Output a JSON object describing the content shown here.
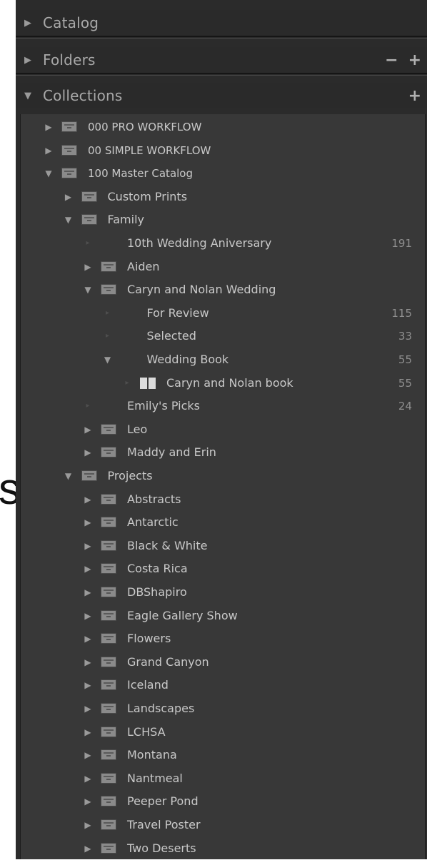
{
  "background_text": "s",
  "panel": {
    "catalog": {
      "label": "Catalog"
    },
    "folders": {
      "label": "Folders",
      "minus": "−",
      "plus": "+"
    },
    "collections": {
      "label": "Collections",
      "plus": "+"
    }
  },
  "collections_tree": [
    {
      "name": "000 PRO WORKFLOW",
      "type": "set",
      "state": "collapsed",
      "depth": 0,
      "count": ""
    },
    {
      "name": "00 SIMPLE WORKFLOW",
      "type": "set",
      "state": "collapsed",
      "depth": 0,
      "count": ""
    },
    {
      "name": "100 Master Catalog",
      "type": "set",
      "state": "expanded",
      "depth": 0,
      "count": ""
    },
    {
      "name": "Custom Prints",
      "type": "set",
      "state": "collapsed",
      "depth": 1,
      "count": ""
    },
    {
      "name": "Family",
      "type": "set",
      "state": "expanded",
      "depth": 1,
      "count": ""
    },
    {
      "name": "10th Wedding Aniversary",
      "type": "collection",
      "state": "leaf",
      "depth": 2,
      "count": "191"
    },
    {
      "name": "Aiden",
      "type": "set",
      "state": "collapsed",
      "depth": 2,
      "count": ""
    },
    {
      "name": "Caryn and Nolan Wedding",
      "type": "set",
      "state": "expanded",
      "depth": 2,
      "count": ""
    },
    {
      "name": "For Review",
      "type": "collection",
      "state": "leaf",
      "depth": 3,
      "count": "115"
    },
    {
      "name": "Selected",
      "type": "collection",
      "state": "leaf",
      "depth": 3,
      "count": "33"
    },
    {
      "name": "Wedding Book",
      "type": "collection",
      "state": "expanded",
      "depth": 3,
      "count": "55"
    },
    {
      "name": "Caryn and Nolan book",
      "type": "book",
      "state": "leaf",
      "depth": 4,
      "count": "55"
    },
    {
      "name": "Emily's Picks",
      "type": "collection",
      "state": "leaf",
      "depth": 2,
      "count": "24"
    },
    {
      "name": "Leo",
      "type": "set",
      "state": "collapsed",
      "depth": 2,
      "count": ""
    },
    {
      "name": "Maddy and Erin",
      "type": "set",
      "state": "collapsed",
      "depth": 2,
      "count": ""
    },
    {
      "name": "Projects",
      "type": "set",
      "state": "expanded",
      "depth": 1,
      "count": ""
    },
    {
      "name": "Abstracts",
      "type": "set",
      "state": "collapsed",
      "depth": 2,
      "count": ""
    },
    {
      "name": "Antarctic",
      "type": "set",
      "state": "collapsed",
      "depth": 2,
      "count": ""
    },
    {
      "name": "Black & White",
      "type": "set",
      "state": "collapsed",
      "depth": 2,
      "count": ""
    },
    {
      "name": "Costa Rica",
      "type": "set",
      "state": "collapsed",
      "depth": 2,
      "count": ""
    },
    {
      "name": "DBShapiro",
      "type": "set",
      "state": "collapsed",
      "depth": 2,
      "count": ""
    },
    {
      "name": "Eagle Gallery Show",
      "type": "set",
      "state": "collapsed",
      "depth": 2,
      "count": ""
    },
    {
      "name": "Flowers",
      "type": "set",
      "state": "collapsed",
      "depth": 2,
      "count": ""
    },
    {
      "name": "Grand Canyon",
      "type": "set",
      "state": "collapsed",
      "depth": 2,
      "count": ""
    },
    {
      "name": "Iceland",
      "type": "set",
      "state": "collapsed",
      "depth": 2,
      "count": ""
    },
    {
      "name": "Landscapes",
      "type": "set",
      "state": "collapsed",
      "depth": 2,
      "count": ""
    },
    {
      "name": "LCHSA",
      "type": "set",
      "state": "collapsed",
      "depth": 2,
      "count": ""
    },
    {
      "name": "Montana",
      "type": "set",
      "state": "collapsed",
      "depth": 2,
      "count": ""
    },
    {
      "name": "Nantmeal",
      "type": "set",
      "state": "collapsed",
      "depth": 2,
      "count": ""
    },
    {
      "name": "Peeper Pond",
      "type": "set",
      "state": "collapsed",
      "depth": 2,
      "count": ""
    },
    {
      "name": "Travel Poster",
      "type": "set",
      "state": "collapsed",
      "depth": 2,
      "count": ""
    },
    {
      "name": "Two Deserts",
      "type": "set",
      "state": "collapsed",
      "depth": 2,
      "count": ""
    }
  ]
}
